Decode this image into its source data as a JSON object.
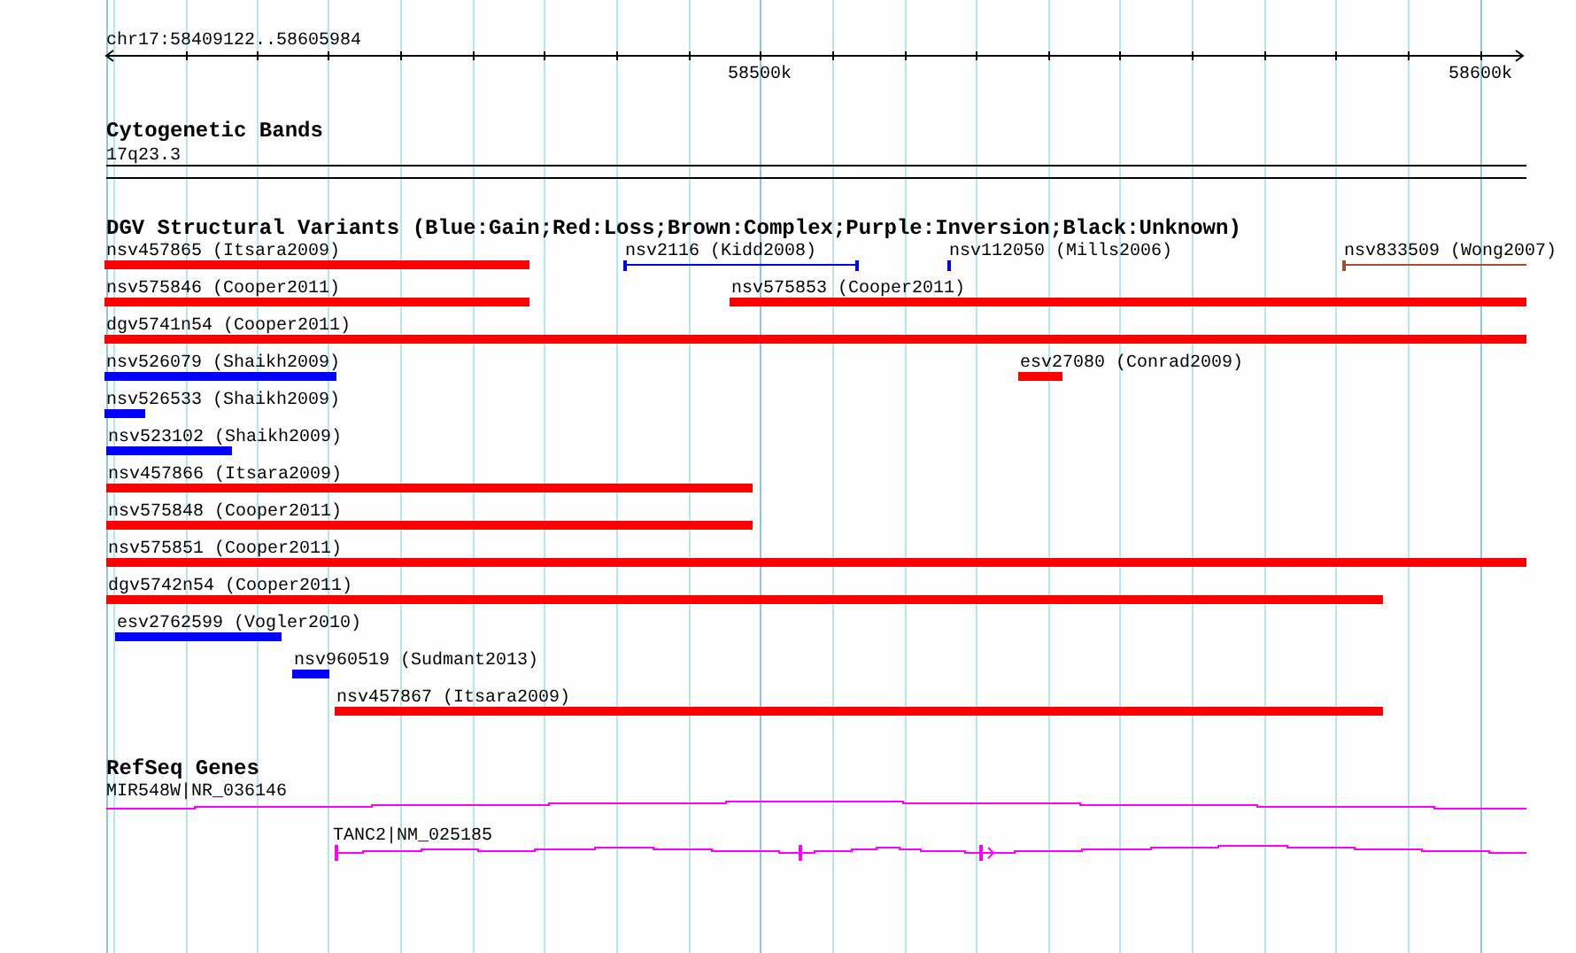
{
  "ruler": {
    "region": "chr17:58409122..58605984",
    "ticks": [
      "58500k",
      "58600k"
    ]
  },
  "tracks": [
    {
      "kind": "bands",
      "title": "Cytogenetic Bands",
      "items": [
        {
          "label": "17q23.3"
        }
      ]
    },
    {
      "kind": "variants",
      "title": "DGV Structural Variants (Blue:Gain;Red:Loss;Brown:Complex;Purple:Inversion;Black:Unknown)",
      "rows": [
        {
          "features": [
            {
              "label": "nsv457865 (Itsara2009)",
              "kind": "bar",
              "color": "#ff0000"
            },
            {
              "label": "nsv2116 (Kidd2008)",
              "kind": "span",
              "color": "#0000ff"
            },
            {
              "label": "nsv112050 (Mills2006)",
              "kind": "span",
              "color": "#0000ff"
            },
            {
              "label": "nsv833509 (Wong2007)",
              "kind": "span",
              "color": "#a0522d"
            }
          ]
        },
        {
          "features": [
            {
              "label": "nsv575846 (Cooper2011)",
              "kind": "bar",
              "color": "#ff0000"
            },
            {
              "label": "nsv575853 (Cooper2011)",
              "kind": "bar",
              "color": "#ff0000"
            }
          ]
        },
        {
          "features": [
            {
              "label": "dgv5741n54 (Cooper2011)",
              "kind": "bar",
              "color": "#ff0000"
            }
          ]
        },
        {
          "features": [
            {
              "label": "nsv526079 (Shaikh2009)",
              "kind": "bar",
              "color": "#0000ff"
            },
            {
              "label": "esv27080 (Conrad2009)",
              "kind": "bar",
              "color": "#ff0000"
            }
          ]
        },
        {
          "features": [
            {
              "label": "nsv526533 (Shaikh2009)",
              "kind": "bar",
              "color": "#0000ff"
            }
          ]
        },
        {
          "features": [
            {
              "label": "nsv523102 (Shaikh2009)",
              "kind": "bar",
              "color": "#0000ff"
            }
          ]
        },
        {
          "features": [
            {
              "label": "nsv457866 (Itsara2009)",
              "kind": "bar",
              "color": "#ff0000"
            }
          ]
        },
        {
          "features": [
            {
              "label": "nsv575848 (Cooper2011)",
              "kind": "bar",
              "color": "#ff0000"
            }
          ]
        },
        {
          "features": [
            {
              "label": "nsv575851 (Cooper2011)",
              "kind": "bar",
              "color": "#ff0000"
            }
          ]
        },
        {
          "features": [
            {
              "label": "dgv5742n54 (Cooper2011)",
              "kind": "bar",
              "color": "#ff0000"
            }
          ]
        },
        {
          "features": [
            {
              "label": "esv2762599 (Vogler2010)",
              "kind": "bar",
              "color": "#0000ff"
            }
          ]
        },
        {
          "features": [
            {
              "label": "nsv960519 (Sudmant2013)",
              "kind": "bar",
              "color": "#0000ff"
            }
          ]
        },
        {
          "features": [
            {
              "label": "nsv457867 (Itsara2009)",
              "kind": "bar",
              "color": "#ff0000"
            }
          ]
        }
      ]
    },
    {
      "kind": "genes",
      "title": "RefSeq Genes",
      "items": [
        {
          "label": "MIR548W|NR_036146"
        },
        {
          "label": "TANC2|NM_025185"
        }
      ]
    }
  ]
}
